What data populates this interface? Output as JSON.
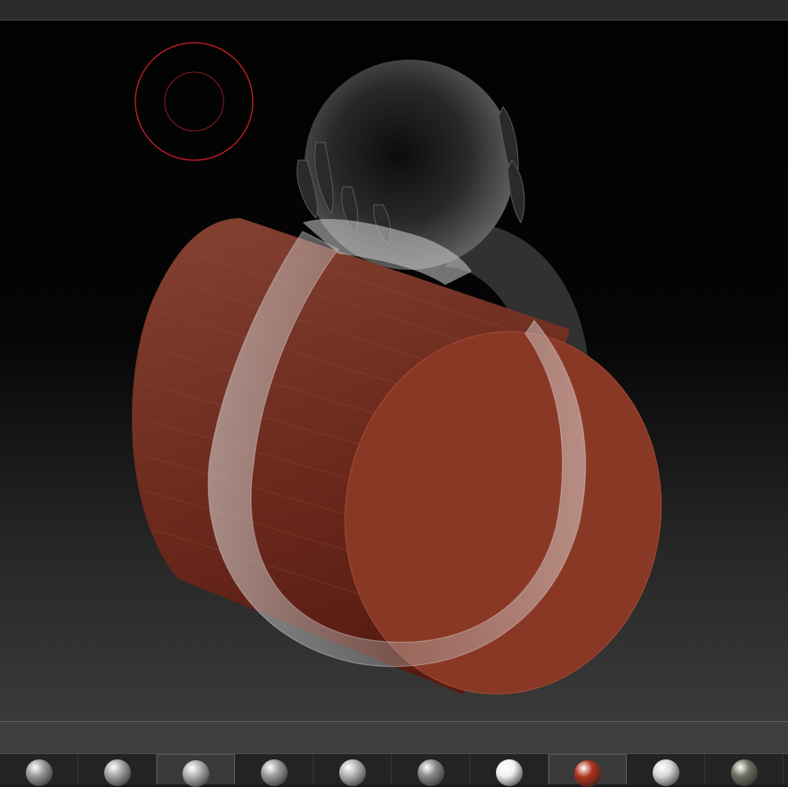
{
  "viewport": {
    "background_top": "#020202",
    "background_bottom": "#3a3a3a",
    "brush_cursor_color": "#c81e2a",
    "cylinder_color": "#8a3826",
    "sculpt_color": "#bfbfbf"
  },
  "shelf": {
    "items": [
      {
        "name": "matcap-clay-rough",
        "color": "#9a9a9a"
      },
      {
        "name": "matcap-clay-stripes",
        "color": "#a4a4a4"
      },
      {
        "name": "matcap-skin-shade",
        "color": "#b0b0b0"
      },
      {
        "name": "matcap-swirl",
        "color": "#9c9c9c"
      },
      {
        "name": "matcap-basic",
        "color": "#b4b4b4"
      },
      {
        "name": "matcap-dark-edge",
        "color": "#8a8a8a"
      },
      {
        "name": "matcap-white-gloss",
        "color": "#f2f2f2"
      },
      {
        "name": "matcap-red-wax",
        "color": "#b0321e"
      },
      {
        "name": "matcap-chrome",
        "color": "#d8d8d8"
      },
      {
        "name": "matcap-olive",
        "color": "#707060"
      }
    ],
    "selected_index": 7,
    "second_highlight_index": 2
  }
}
